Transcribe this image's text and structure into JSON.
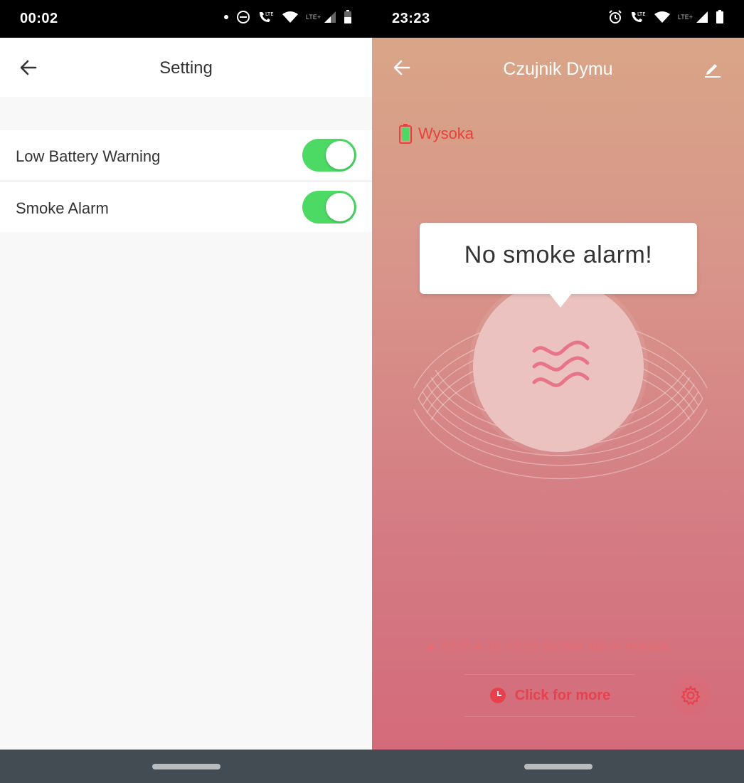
{
  "left_screen": {
    "status_bar": {
      "time": "00:02"
    },
    "header": {
      "title": "Setting"
    },
    "settings": [
      {
        "label": "Low Battery Warning",
        "enabled": true
      },
      {
        "label": "Smoke Alarm",
        "enabled": true
      }
    ]
  },
  "right_screen": {
    "status_bar": {
      "time": "23:23"
    },
    "header": {
      "title": "Czujnik Dymu"
    },
    "battery": {
      "label": "Wysoka",
      "status_color": "#e8413b"
    },
    "status_message": "No smoke alarm!",
    "last_event": "2020.4.18 23:20 Smoke alarm release",
    "more_button_label": "Click for more"
  },
  "colors": {
    "toggle_on": "#4cd964",
    "accent_red": "#e8414e",
    "battery_fill": "#4cd964"
  }
}
